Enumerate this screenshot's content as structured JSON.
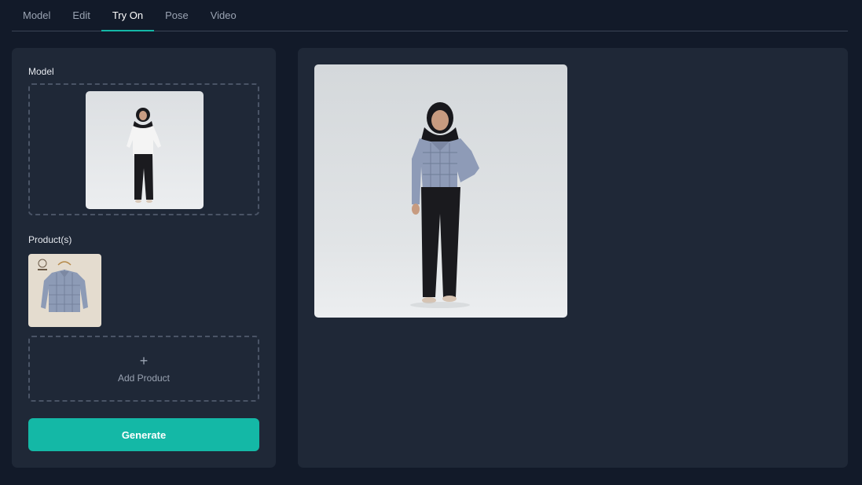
{
  "tabs": [
    {
      "label": "Model"
    },
    {
      "label": "Edit"
    },
    {
      "label": "Try On"
    },
    {
      "label": "Pose"
    },
    {
      "label": "Video"
    }
  ],
  "active_tab": "Try On",
  "left_panel": {
    "model_label": "Model",
    "products_label": "Product(s)",
    "add_product_icon": "plus-icon",
    "add_product_label": "Add Product",
    "generate_label": "Generate"
  },
  "colors": {
    "accent": "#14b8a6",
    "background": "#121a29",
    "panel": "#1f2837"
  }
}
